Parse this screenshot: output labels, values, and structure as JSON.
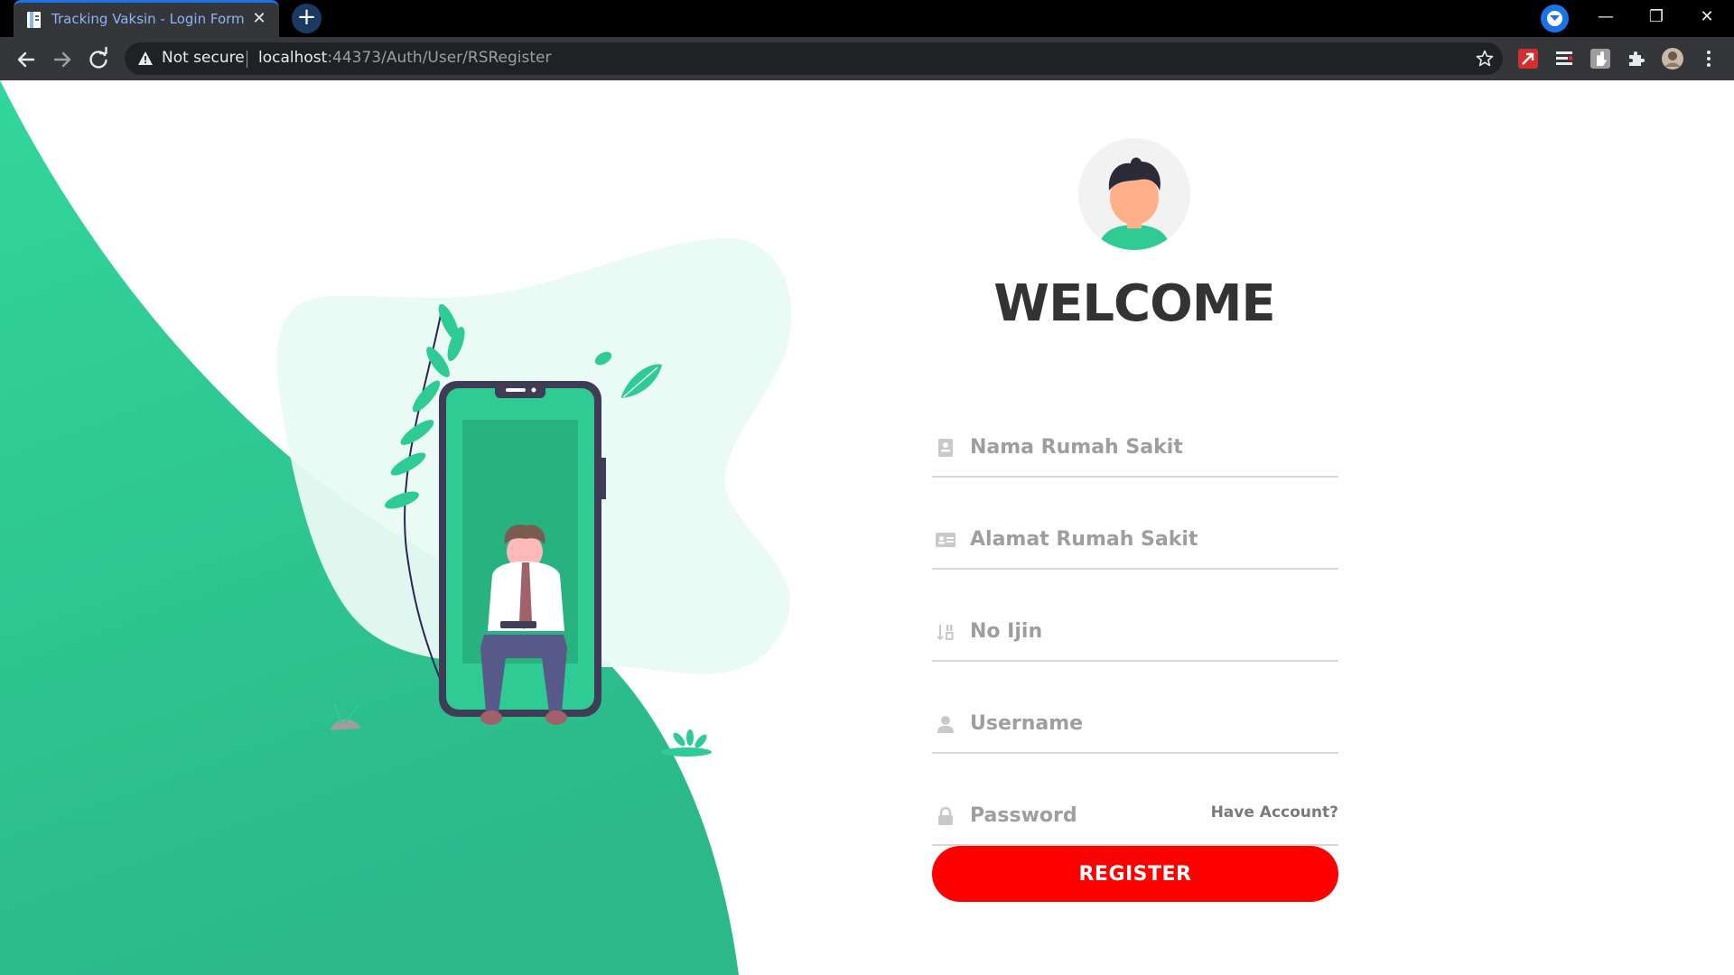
{
  "browser": {
    "tab_title": "Tracking Vaksin - Login Form",
    "tab_close": "✕",
    "new_tab_symbol": "+",
    "security_label": "Not secure",
    "url_host": "localhost",
    "url_path": ":44373/Auth/User/RSRegister",
    "window_minimize": "—",
    "window_restore": "❐",
    "window_close": "✕"
  },
  "page": {
    "heading": "WELCOME",
    "fields": [
      {
        "name": "nama-rumah-sakit",
        "placeholder": "Nama Rumah Sakit",
        "value": "",
        "icon": "id-card-icon"
      },
      {
        "name": "alamat-rumah-sakit",
        "placeholder": "Alamat Rumah Sakit",
        "value": "",
        "icon": "address-card-icon"
      },
      {
        "name": "no-ijin",
        "placeholder": "No Ijin",
        "value": "",
        "icon": "sort-numeric-icon"
      },
      {
        "name": "username",
        "placeholder": "Username",
        "value": "",
        "icon": "user-icon"
      },
      {
        "name": "password",
        "placeholder": "Password",
        "value": "",
        "icon": "lock-icon"
      }
    ],
    "have_account_link": "Have Account?",
    "register_button": "REGISTER"
  },
  "colors": {
    "accent_green": "#2ecb94",
    "button_red": "#ff0000",
    "heading": "#333333",
    "tab_highlight": "#1a73e8"
  }
}
